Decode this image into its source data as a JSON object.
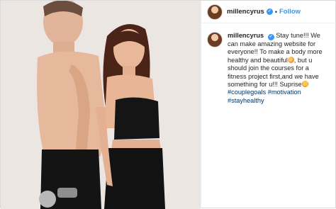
{
  "post": {
    "username": "millencyrus",
    "follow_label": "Follow",
    "separator": "•",
    "caption": {
      "username": "millencyrus",
      "line_1": "Stay tune!!! We can make amazing website for everyone!! To make a body more healthy and beautiful",
      "line_2": ", but u should join the courses for a fitness project first,and we have something for u!!! Suprise",
      "hashtags": [
        "#couplegoals",
        "#motivation",
        "#stayhealthy"
      ]
    }
  },
  "colors": {
    "link": "#3897f0",
    "hashtag": "#003569",
    "text": "#262626"
  },
  "icons": {
    "verified": "verified-badge-icon",
    "emoji_1": "facepalm-emoji-icon",
    "emoji_2": "heart-eyes-emoji-icon"
  }
}
